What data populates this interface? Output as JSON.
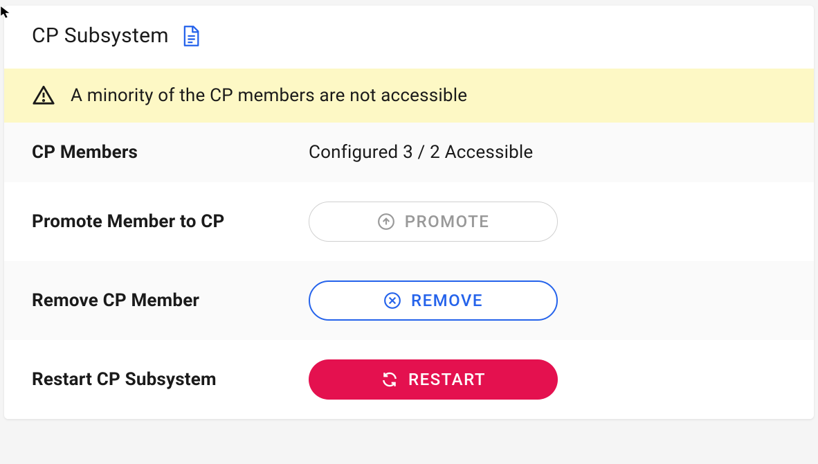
{
  "header": {
    "title": "CP Subsystem"
  },
  "alert": {
    "message": "A minority of the CP members are not accessible"
  },
  "members": {
    "label": "CP Members",
    "value": "Configured 3 / 2 Accessible"
  },
  "promote": {
    "label": "Promote Member to CP",
    "button": "PROMOTE"
  },
  "remove": {
    "label": "Remove CP Member",
    "button": "REMOVE"
  },
  "restart": {
    "label": "Restart CP Subsystem",
    "button": "RESTART"
  }
}
